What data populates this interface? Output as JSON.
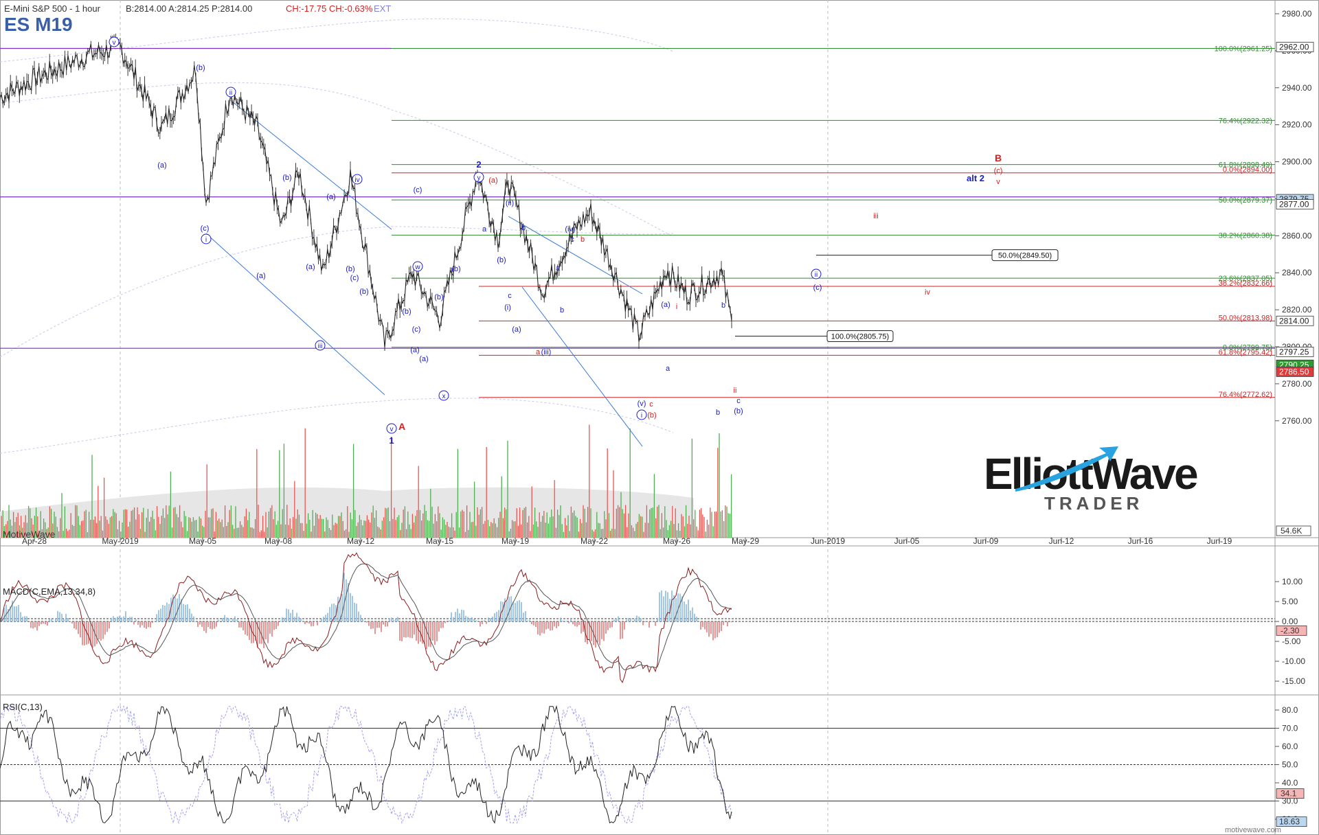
{
  "header": {
    "chart_title": "E-Mini S&P 500 - 1 hour",
    "quote_bap": "B:2814.00  A:2814.25  P:2814.00",
    "quote_change": "CH:-17.75  CH:-0.63%",
    "quote_ext": "EXT",
    "symbol": "ES M19"
  },
  "footer": {
    "left_watermark": "MotiveWave",
    "right_watermark": "motivewave.com"
  },
  "logo": {
    "line1": "ElliottWave",
    "line2": "TRADER"
  },
  "colors": {
    "price": "#222222",
    "up_volume": "#4caf50",
    "down_volume": "#ef5350",
    "fib_green": "#2e8b2e",
    "fib_red": "#d62020",
    "purple": "#7b2fbf",
    "channel": "#3a7ad6",
    "wave_blue": "#1a1acc",
    "wave_red": "#d62020",
    "macd_line": "#8b1a1a",
    "macd_signal": "#555555",
    "rsi_line": "#222222"
  },
  "main_axis": {
    "ticks": [
      "2980.00",
      "2960.00",
      "2940.00",
      "2920.00",
      "2900.00",
      "2880.00",
      "2860.00",
      "2840.00",
      "2820.00",
      "2800.00",
      "2780.00",
      "2760.00"
    ],
    "tick_values": [
      2980,
      2960,
      2940,
      2920,
      2900,
      2880,
      2860,
      2840,
      2820,
      2800,
      2780,
      2760
    ],
    "price_tags": [
      {
        "label": "2962.00",
        "value": 2962.0,
        "style": "box"
      },
      {
        "label": "2879.75",
        "value": 2879.75,
        "style": "blue"
      },
      {
        "label": "2877.00",
        "value": 2877.0,
        "style": "box"
      },
      {
        "label": "2814.00",
        "value": 2814.0,
        "style": "box"
      },
      {
        "label": "2797.25",
        "value": 2797.25,
        "style": "box"
      },
      {
        "label": "2790.25",
        "value": 2790.25,
        "style": "green"
      },
      {
        "label": "2786.50",
        "value": 2786.5,
        "style": "red"
      }
    ],
    "volume_tag": "54.6K"
  },
  "dates": [
    "Apr-28",
    "May-2019",
    "May-05",
    "May-08",
    "May-12",
    "May-15",
    "May-19",
    "May-22",
    "May-26",
    "May-29",
    "Jun-2019",
    "Jun-05",
    "Jun-09",
    "Jun-12",
    "Jun-16",
    "Jun-19"
  ],
  "fib_levels": [
    {
      "label": "100.0%(2961.25)",
      "value": 2961.25,
      "color": "green"
    },
    {
      "label": "76.4%(2922.32)",
      "value": 2922.32,
      "color": "green"
    },
    {
      "label": "61.8%(2898.49)",
      "value": 2898.49,
      "color": "green"
    },
    {
      "label": "0.0%(2894.00)",
      "value": 2894.0,
      "color": "red"
    },
    {
      "label": "50.0%(2879.37)",
      "value": 2879.37,
      "color": "green"
    },
    {
      "label": "38.2%(2860.38)",
      "value": 2860.38,
      "color": "green"
    },
    {
      "label": "23.6%(2837.05)",
      "value": 2837.05,
      "color": "green"
    },
    {
      "label": "38.2%(2832.66)",
      "value": 2832.66,
      "color": "red"
    },
    {
      "label": "50.0%(2813.98)",
      "value": 2813.98,
      "color": "red"
    },
    {
      "label": "0.0%(2799.75)",
      "value": 2799.75,
      "color": "green"
    },
    {
      "label": "61.8%(2795.42)",
      "value": 2795.42,
      "color": "red"
    },
    {
      "label": "76.4%(2772.62)",
      "value": 2772.62,
      "color": "red"
    }
  ],
  "callouts": [
    {
      "label": "50.0%(2849.50)",
      "value": 2849.5
    },
    {
      "label": "100.0%(2805.75)",
      "value": 2805.75
    }
  ],
  "wave_labels": {
    "blue_plain": [
      "(b)",
      "(a)",
      "(c)",
      "(b)",
      "(a)",
      "(b)",
      "(a)",
      "(c)",
      "(b)",
      "(a)",
      "(b)",
      "(a)",
      "(b)",
      "(c)",
      "(b)",
      "(a)",
      "(c)",
      "(b)",
      "(a)",
      "(i)",
      "(ii)",
      "(iii)",
      "(iv)",
      "(v)",
      "(a)",
      "(c)",
      "(b)",
      "a",
      "b",
      "c",
      "a",
      "b",
      "c",
      "a",
      "b",
      "b",
      "c",
      "alt 2",
      "1",
      "2"
    ],
    "blue_circled": [
      "v",
      "ii",
      "iv",
      "i",
      "iii",
      "w",
      "x",
      "y",
      "v",
      "i",
      "ii"
    ],
    "red": [
      "(a)",
      "a",
      "b",
      "c",
      "(b)",
      "i",
      "ii",
      "iii",
      "iv",
      "B",
      "(c)",
      "v",
      "A"
    ]
  },
  "macd": {
    "title": "MACD(C,EMA,13,34,8)",
    "ticks": [
      "10.00",
      "5.00",
      "0.00",
      "-5.00",
      "-10.00",
      "-15.00"
    ],
    "tick_values": [
      10,
      5,
      0,
      -5,
      -10,
      -15
    ],
    "last_value": "-2.30",
    "last_num": -2.3
  },
  "rsi": {
    "title": "RSI(C,13)",
    "ticks": [
      "80.0",
      "70.0",
      "60.0",
      "50.0",
      "40.0",
      "30.0",
      "20.0"
    ],
    "tick_values": [
      80,
      70,
      60,
      50,
      40,
      30,
      20
    ],
    "last_value": "34.1",
    "last_num": 34.1,
    "stoch_value": "18.63",
    "stoch_num": 18.63
  },
  "chart_data": {
    "type": "line",
    "title": "E-Mini S&P 500 - 1 hour",
    "series": [
      {
        "name": "ES M19",
        "x": [
          "Apr-26",
          "Apr-28",
          "Apr-30",
          "May-01",
          "May-02",
          "May-03",
          "May-05",
          "May-06",
          "May-07",
          "May-08",
          "May-09",
          "May-10",
          "May-12",
          "May-13",
          "May-14",
          "May-15",
          "May-16",
          "May-17",
          "May-19",
          "May-20",
          "May-21",
          "May-22",
          "May-23",
          "May-24",
          "May-26",
          "May-27",
          "May-28"
        ],
        "values": [
          2935,
          2945,
          2958,
          2962,
          2918,
          2950,
          2878,
          2938,
          2918,
          2865,
          2895,
          2840,
          2893,
          2801,
          2840,
          2815,
          2894,
          2858,
          2890,
          2830,
          2865,
          2873,
          2806,
          2842,
          2828,
          2840,
          2814
        ]
      }
    ],
    "ylim": [
      2745,
      2990
    ],
    "xlabel": "",
    "ylabel": "",
    "grid": false
  }
}
